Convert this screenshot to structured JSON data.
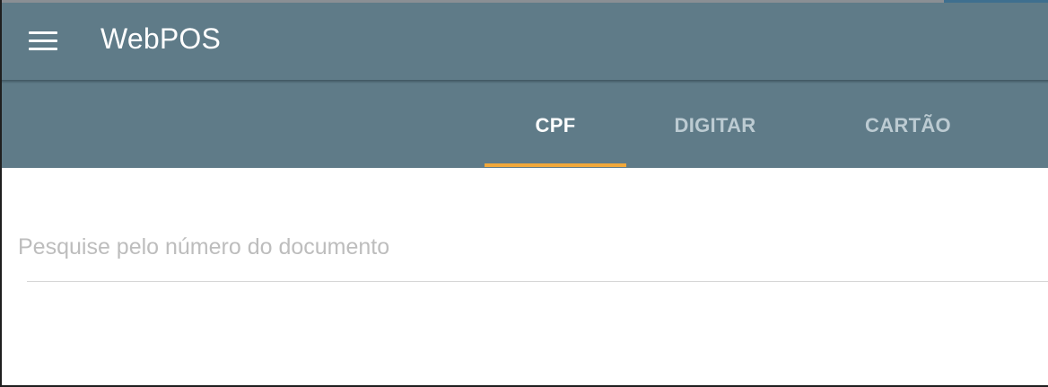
{
  "app": {
    "title": "WebPOS",
    "menu_icon": "hamburger-menu-icon"
  },
  "tabs": [
    {
      "label": "CPF",
      "active": true
    },
    {
      "label": "DIGITAR",
      "active": false
    },
    {
      "label": "CARTÃO",
      "active": false
    }
  ],
  "search": {
    "placeholder": "Pesquise pelo número do documento",
    "value": ""
  },
  "colors": {
    "appbar": "#5f7b88",
    "tab_indicator": "#f1a83a",
    "active_tab_text": "#ffffff",
    "inactive_tab_text": "#bccbd2",
    "placeholder": "#bdbdbd"
  }
}
